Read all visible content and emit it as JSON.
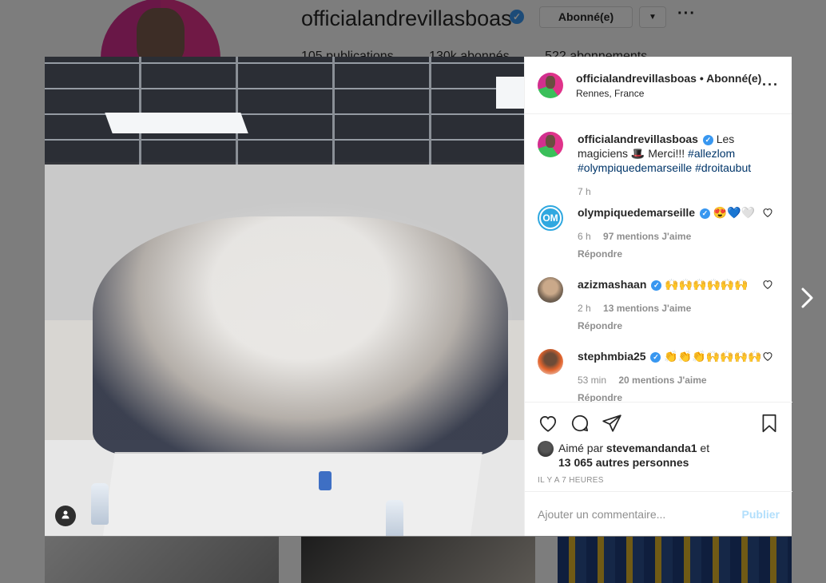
{
  "profile": {
    "username": "officialandrevillasboas",
    "follow_label": "Abonné(e)",
    "dropdown_icon": "chevron-down-icon",
    "more_icon": "more-options-icon",
    "stats": {
      "publications": "105 publications",
      "followers": "130k abonnés",
      "following": "522 abonnements"
    }
  },
  "post": {
    "header": {
      "username": "officialandrevillasboas",
      "separator": "•",
      "follow_status": "Abonné(e)",
      "location": "Rennes, France"
    },
    "caption": {
      "username": "officialandrevillasboas",
      "text_part1": "Les magiciens 🎩 Merci!!!",
      "hashtags": [
        "#allezlom",
        "#olympiquedemarseille",
        "#droitaubut"
      ],
      "time": "7 h"
    },
    "comments": [
      {
        "username": "olympiquedemarseille",
        "text": "😍💙🤍",
        "time": "6 h",
        "likes": "97 mentions J'aime",
        "reply": "Répondre"
      },
      {
        "username": "azizmashaan",
        "text": "🙌🙌🙌🙌🙌🙌",
        "time": "2 h",
        "likes": "13 mentions J'aime",
        "reply": "Répondre"
      },
      {
        "username": "stephmbia25",
        "text": "👏👏👏🙌🙌🙌🙌",
        "time": "53 min",
        "likes": "20 mentions J'aime",
        "reply": "Répondre"
      }
    ],
    "liked_by": {
      "prefix": "Aimé par",
      "user": "stevemandanda1",
      "conjunction": "et",
      "others": "13 065 autres personnes"
    },
    "time_ago": "IL Y A 7 HEURES",
    "comment_input": {
      "placeholder": "Ajouter un commentaire...",
      "publish_label": "Publier"
    }
  },
  "icons": {
    "like": "heart-icon",
    "comment": "comment-icon",
    "share": "send-icon",
    "save": "bookmark-icon",
    "next": "chevron-right-icon",
    "tag": "user-tag-icon"
  },
  "colors": {
    "link": "#003569",
    "verified": "#3897f0",
    "muted": "#8e8e8e",
    "publish_disabled": "#b2dffc"
  }
}
